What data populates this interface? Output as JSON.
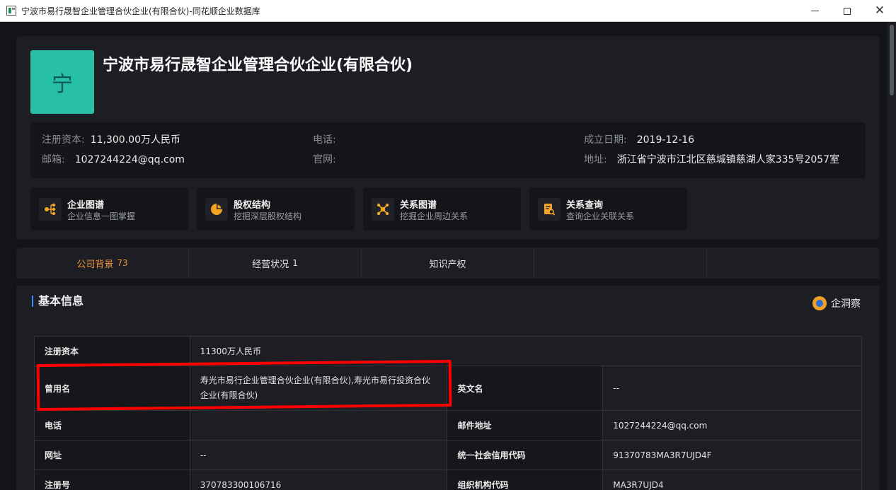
{
  "window": {
    "title": "宁波市易行晟智企业管理合伙企业(有限合伙)-同花顺企业数据库",
    "minimize_label": "",
    "close_label": "✕"
  },
  "company": {
    "logo_char": "宁",
    "name": "宁波市易行晟智企业管理合伙企业(有限合伙)"
  },
  "summary": {
    "capital_label": "注册资本:",
    "capital_value": "11,300.00万人民币",
    "phone_label": "电话:",
    "phone_value": "",
    "founded_label": "成立日期:",
    "founded_value": "2019-12-16",
    "email_label": "邮箱:",
    "email_value": "1027244224@qq.com",
    "website_label": "官网:",
    "website_value": "",
    "address_label": "地址:",
    "address_value": "浙江省宁波市江北区慈城镇慈湖人家335号2057室"
  },
  "features": [
    {
      "title": "企业图谱",
      "subtitle": "企业信息一图掌握",
      "icon": "org-chart-icon"
    },
    {
      "title": "股权结构",
      "subtitle": "挖掘深层股权结构",
      "icon": "pie-chart-icon"
    },
    {
      "title": "关系图谱",
      "subtitle": "挖掘企业周边关系",
      "icon": "network-icon"
    },
    {
      "title": "关系查询",
      "subtitle": "查询企业关联关系",
      "icon": "document-search-icon"
    }
  ],
  "tabs": [
    {
      "label": "公司背景",
      "count": "73"
    },
    {
      "label": "经营状况",
      "count": "1"
    },
    {
      "label": "知识产权",
      "count": ""
    },
    {
      "label": "",
      "count": ""
    },
    {
      "label": "",
      "count": ""
    }
  ],
  "section": {
    "title": "基本信息",
    "brand": "企洞察"
  },
  "basic_info": {
    "reg_capital_label": "注册资本",
    "reg_capital_value": "11300万人民币",
    "former_name_label": "曾用名",
    "former_name_value": "寿光市易行企业管理合伙企业(有限合伙),寿光市易行投资合伙企业(有限合伙)",
    "english_name_label": "英文名",
    "english_name_value": "--",
    "phone_label": "电话",
    "phone_value": "",
    "email_label": "邮件地址",
    "email_value": "1027244224@qq.com",
    "website_label": "网址",
    "website_value": "--",
    "credit_code_label": "统一社会信用代码",
    "credit_code_value": "91370783MA3R7UJD4F",
    "reg_no_label": "注册号",
    "reg_no_value": "370783300106716",
    "org_code_label": "组织机构代码",
    "org_code_value": "MA3R7UJD4"
  },
  "colors": {
    "accent_orange": "#f0943a",
    "logo_teal": "#27bfa8",
    "feature_icon_orange": "#f5a623",
    "annotation_red": "#ff0000"
  }
}
